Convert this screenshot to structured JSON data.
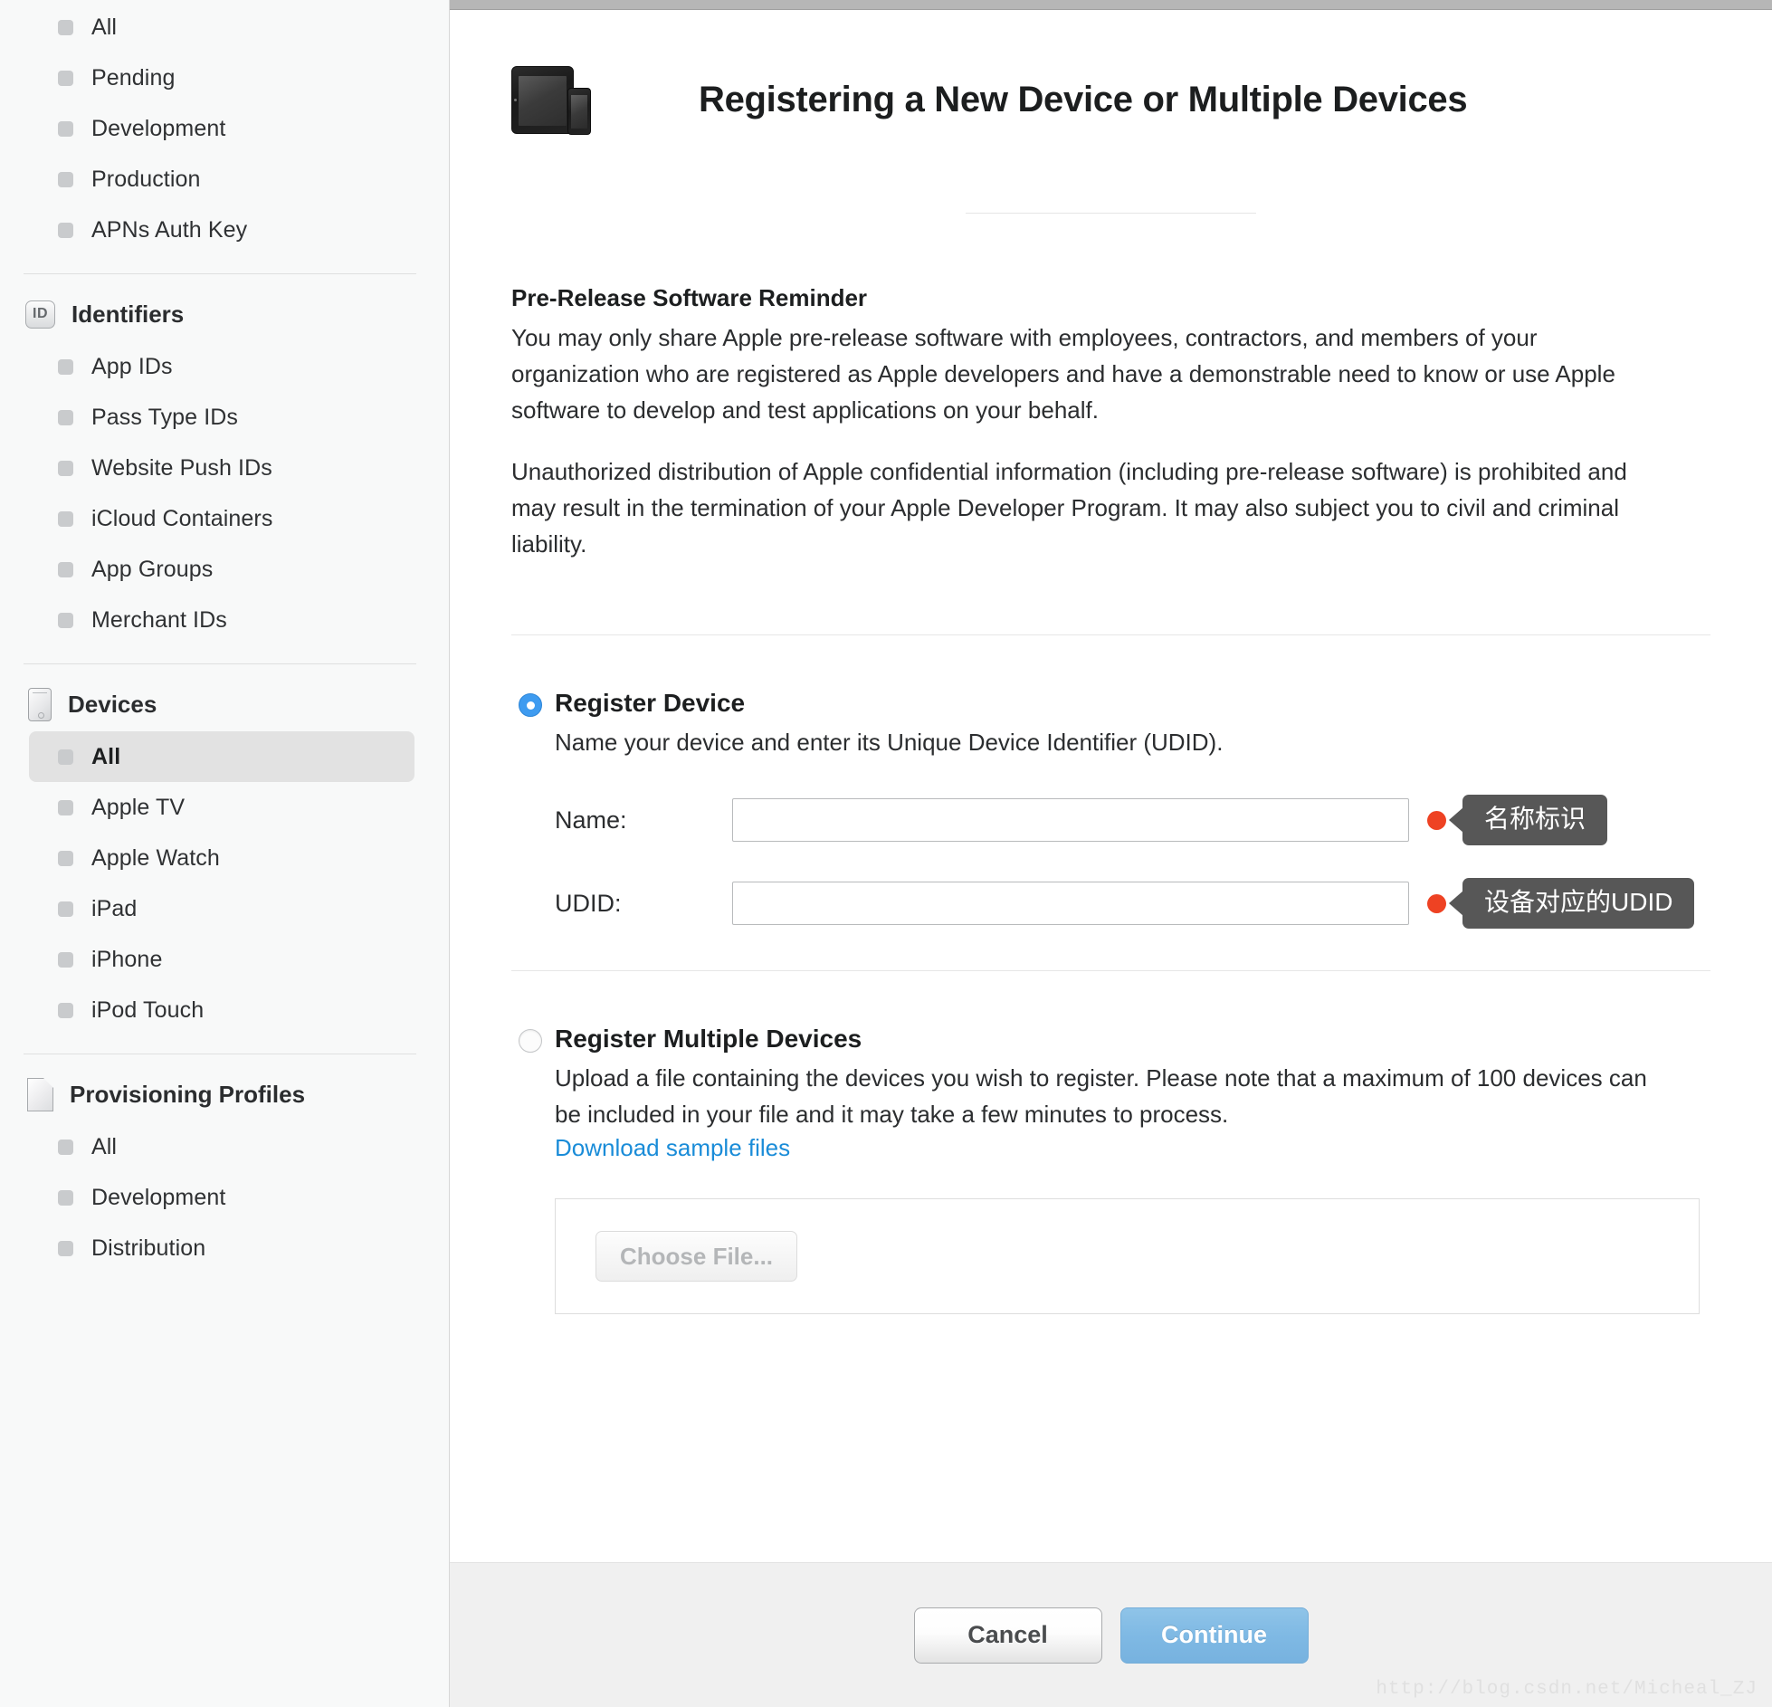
{
  "sidebar": {
    "top_items": [
      {
        "label": "All",
        "selected": false
      },
      {
        "label": "Pending",
        "selected": false
      },
      {
        "label": "Development",
        "selected": false
      },
      {
        "label": "Production",
        "selected": false
      },
      {
        "label": "APNs Auth Key",
        "selected": false
      }
    ],
    "groups": [
      {
        "title": "Identifiers",
        "icon": "id-badge-icon",
        "items": [
          {
            "label": "App IDs",
            "selected": false
          },
          {
            "label": "Pass Type IDs",
            "selected": false
          },
          {
            "label": "Website Push IDs",
            "selected": false
          },
          {
            "label": "iCloud Containers",
            "selected": false
          },
          {
            "label": "App Groups",
            "selected": false
          },
          {
            "label": "Merchant IDs",
            "selected": false
          }
        ]
      },
      {
        "title": "Devices",
        "icon": "mobile-device-icon",
        "items": [
          {
            "label": "All",
            "selected": true
          },
          {
            "label": "Apple TV",
            "selected": false
          },
          {
            "label": "Apple Watch",
            "selected": false
          },
          {
            "label": "iPad",
            "selected": false
          },
          {
            "label": "iPhone",
            "selected": false
          },
          {
            "label": "iPod Touch",
            "selected": false
          }
        ]
      },
      {
        "title": "Provisioning Profiles",
        "icon": "document-icon",
        "items": [
          {
            "label": "All",
            "selected": false
          },
          {
            "label": "Development",
            "selected": false
          },
          {
            "label": "Distribution",
            "selected": false
          }
        ]
      }
    ]
  },
  "header": {
    "icon": "ipad-iphone-icon",
    "title": "Registering a New Device or Multiple Devices"
  },
  "notice": {
    "heading": "Pre-Release Software Reminder",
    "paragraph_1": "You may only share Apple pre-release software with employees, contractors, and members of your organization who are registered as Apple developers and have a demonstrable need to know or use Apple software to develop and test applications on your behalf.",
    "paragraph_2": "Unauthorized distribution of Apple confidential information (including pre-release software) is prohibited and may result in the termination of your Apple Developer Program. It may also subject you to civil and criminal liability."
  },
  "register_device": {
    "selected": true,
    "title": "Register Device",
    "description": "Name your device and enter its Unique Device Identifier (UDID).",
    "fields": [
      {
        "label": "Name:",
        "value": "",
        "placeholder": "",
        "annotation": "名称标识"
      },
      {
        "label": "UDID:",
        "value": "",
        "placeholder": "",
        "annotation": "设备对应的UDID"
      }
    ]
  },
  "register_multiple": {
    "selected": false,
    "title": "Register Multiple Devices",
    "description": "Upload a file containing the devices you wish to register. Please note that a maximum of 100 devices can be included in your file and it may take a few minutes to process.",
    "link_label": "Download sample files",
    "choose_file_label": "Choose File..."
  },
  "footer": {
    "cancel_label": "Cancel",
    "continue_label": "Continue",
    "watermark": "http://blog.csdn.net/Micheal_ZJ"
  },
  "colors": {
    "accent_blue": "#3e9bf0",
    "link_blue": "#1a8cd8",
    "annotation_red": "#ee4223",
    "callout_gray": "#575757",
    "continue_blue": "#7fb9e4"
  }
}
